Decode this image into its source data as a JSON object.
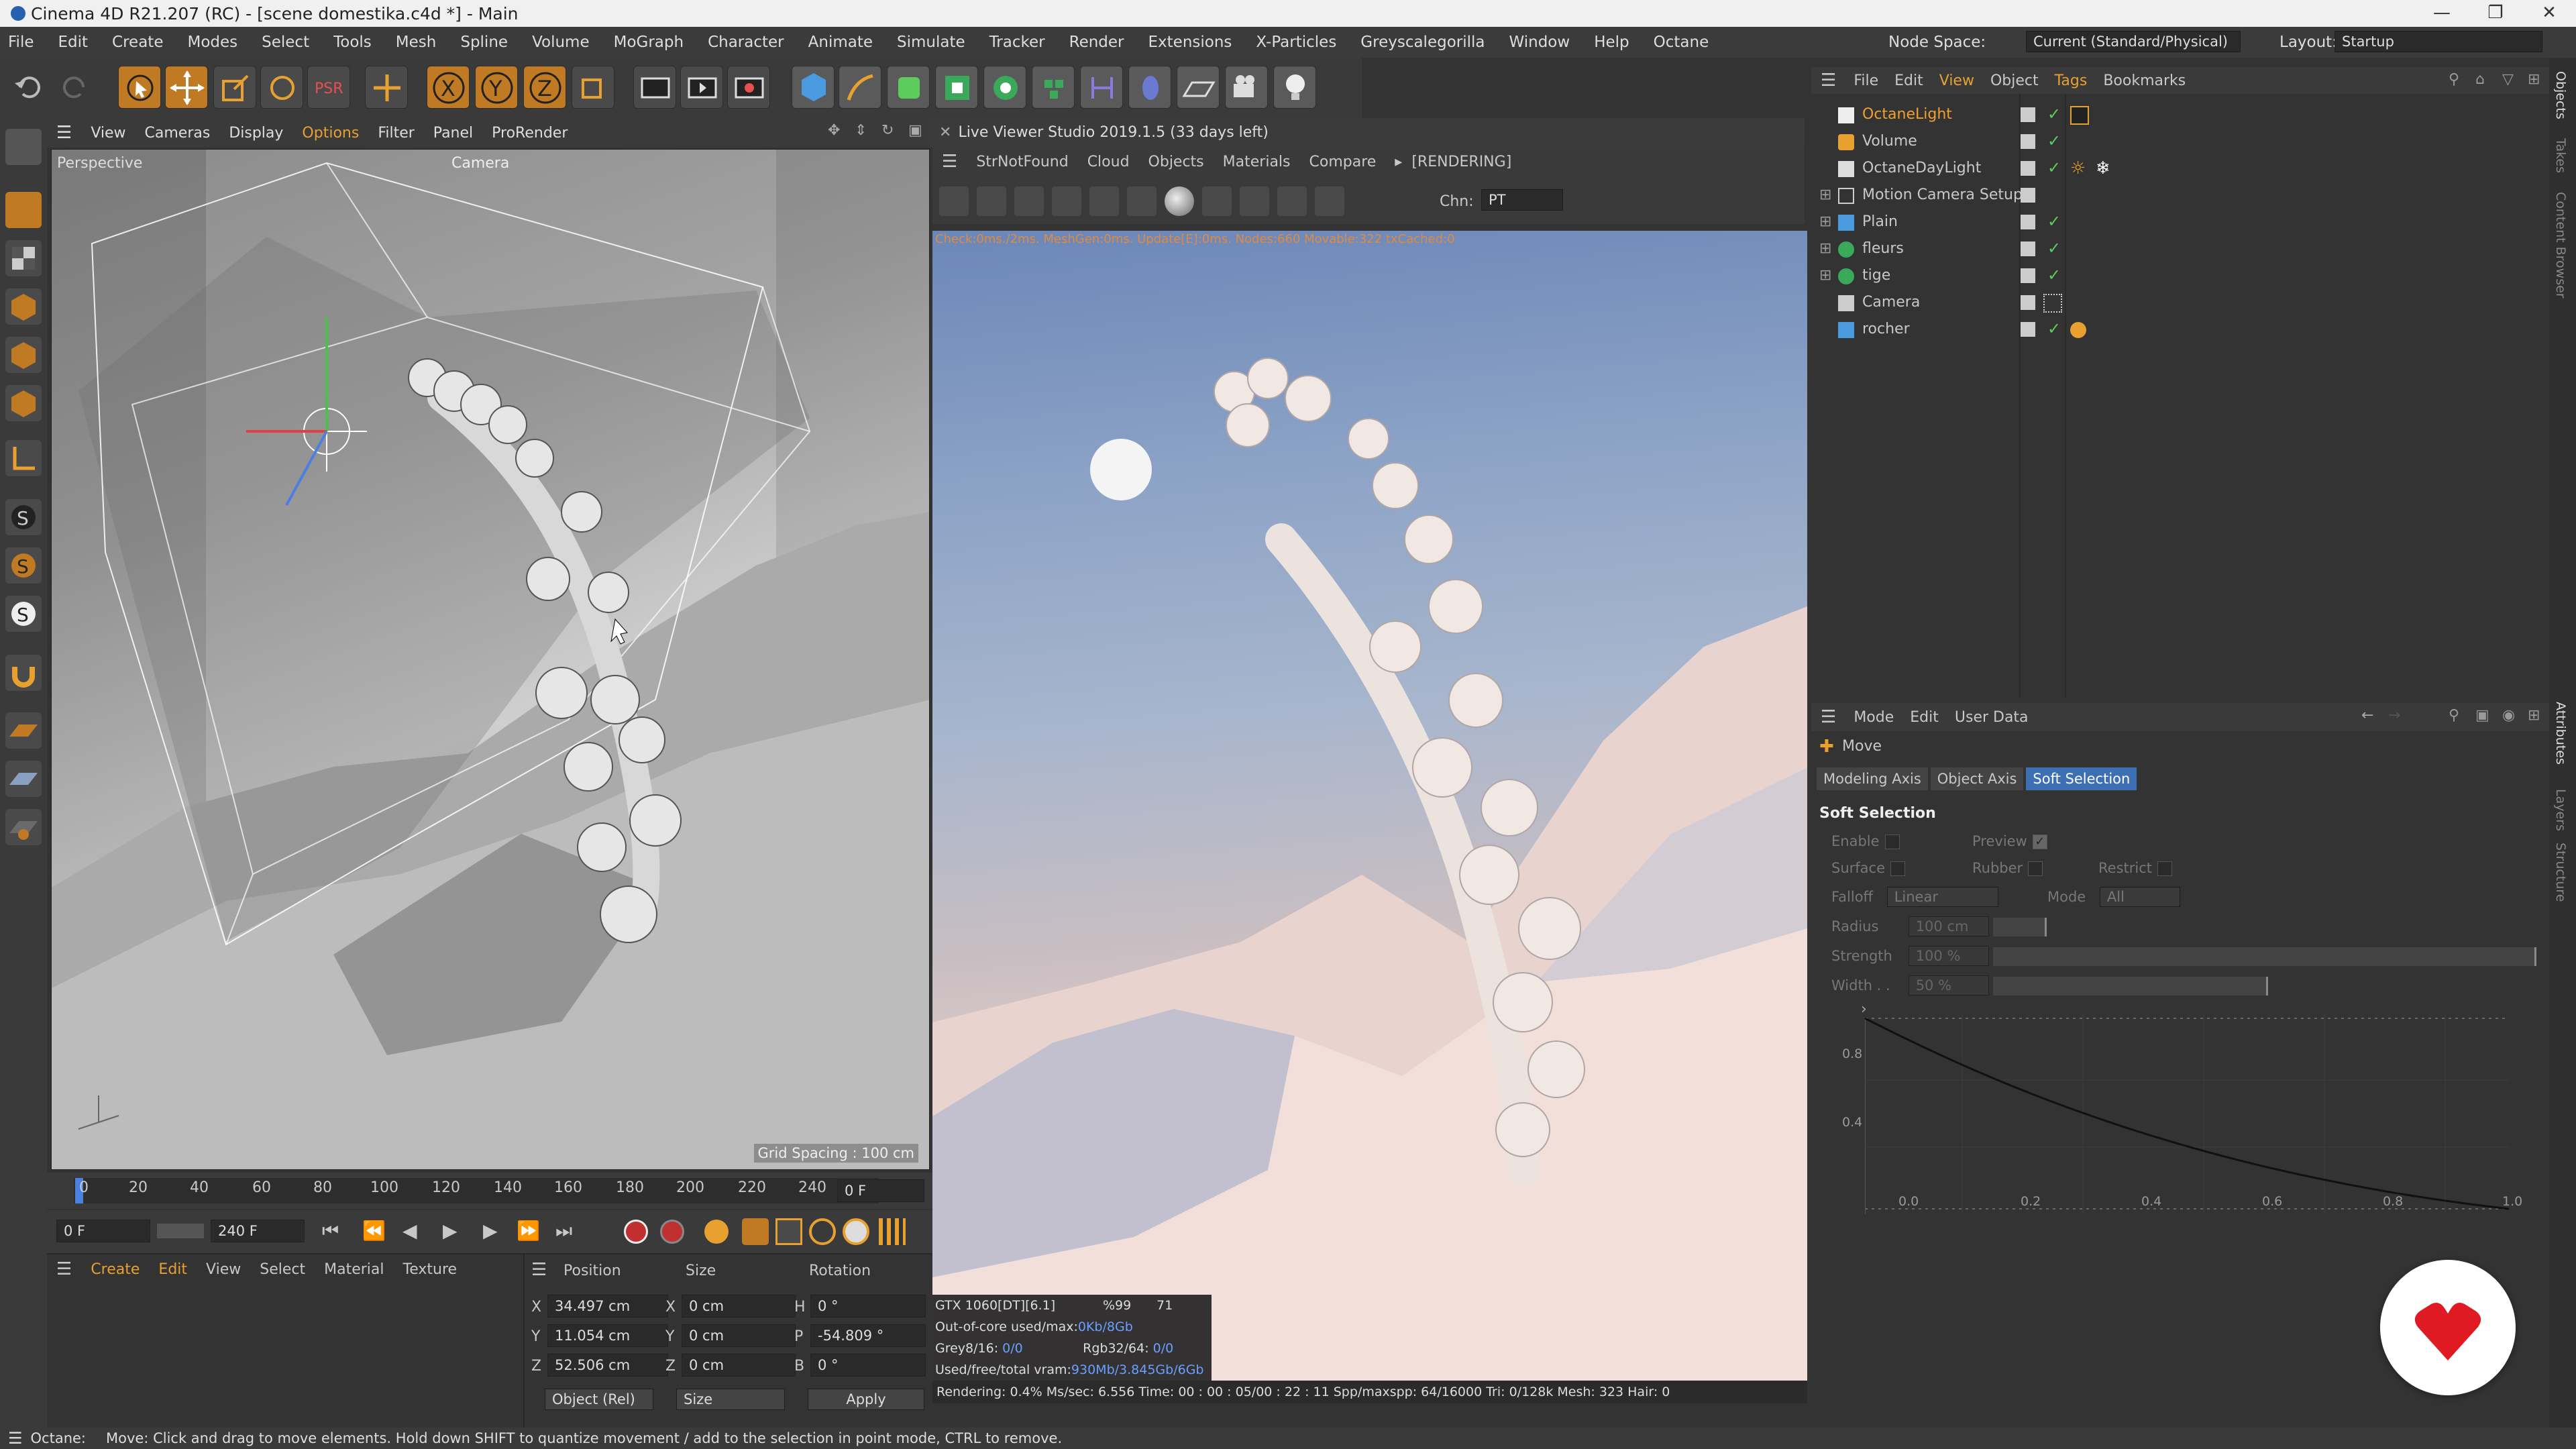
{
  "title": "Cinema 4D R21.207 (RC) - [scene domestika.c4d *] - Main",
  "menu": [
    "File",
    "Edit",
    "Create",
    "Modes",
    "Select",
    "Tools",
    "Mesh",
    "Spline",
    "Volume",
    "MoGraph",
    "Character",
    "Animate",
    "Simulate",
    "Tracker",
    "Render",
    "Extensions",
    "X-Particles",
    "Greyscalegorilla",
    "Window",
    "Help",
    "Octane"
  ],
  "node_space": {
    "label": "Node Space:",
    "value": "Current (Standard/Physical)"
  },
  "layout": {
    "label": "Layout:",
    "value": "Startup"
  },
  "viewport": {
    "menu": [
      "View",
      "Cameras",
      "Display",
      "Options",
      "Filter",
      "Panel",
      "ProRender"
    ],
    "name": "Perspective",
    "camera": "Camera",
    "grid_spacing": "Grid Spacing : 100 cm"
  },
  "timeline": {
    "ticks": [
      "0",
      "20",
      "40",
      "60",
      "80",
      "100",
      "120",
      "140",
      "160",
      "180",
      "200",
      "220",
      "240"
    ],
    "frame_field": "0 F"
  },
  "playback": {
    "start": "0 F",
    "end": "240 F"
  },
  "material_menu": [
    "Create",
    "Edit",
    "View",
    "Select",
    "Material",
    "Texture"
  ],
  "coords": {
    "headers": [
      "Position",
      "Size",
      "Rotation"
    ],
    "rows": [
      {
        "axis": "X",
        "pos": "34.497 cm",
        "size_axis": "X",
        "size": "0 cm",
        "rot_axis": "H",
        "rot": "0 °"
      },
      {
        "axis": "Y",
        "pos": "11.054 cm",
        "size_axis": "Y",
        "size": "0 cm",
        "rot_axis": "P",
        "rot": "-54.809 °"
      },
      {
        "axis": "Z",
        "pos": "52.506 cm",
        "size_axis": "Z",
        "size": "0 cm",
        "rot_axis": "B",
        "rot": "0 °"
      }
    ],
    "mode": "Object (Rel)",
    "size_mode": "Size",
    "apply": "Apply"
  },
  "live_viewer": {
    "title": "Live Viewer Studio 2019.1.5 (33 days left)",
    "menu": [
      "StrNotFound",
      "Cloud",
      "Objects",
      "Materials",
      "Compare"
    ],
    "status": "[RENDERING]",
    "channel_label": "Chn:",
    "channel": "PT",
    "check": "Check:0ms./2ms. MeshGen:0ms. Update[E]:0ms. Nodes:660 Movable:322 txCached:0",
    "gpu": "GTX 1060[DT][6.1]",
    "gpu_pct": "%99",
    "gpu_temp": "71",
    "outofcore_label": "Out-of-core used/max:",
    "outofcore": "0Kb/8Gb",
    "grey_label": "Grey8/16:",
    "grey": "0/0",
    "rgb_label": "Rgb32/64:",
    "rgb": "0/0",
    "vram_label": "Used/free/total vram:",
    "vram": "930Mb/3.845Gb/6Gb",
    "render_status": "Rendering: 0.4%   Ms/sec: 6.556   Time: 00 : 00 : 05/00 : 22 : 11   Spp/maxspp: 64/16000   Tri: 0/128k   Mesh: 323   Hair: 0"
  },
  "obj_menu": [
    "File",
    "Edit",
    "View",
    "Object",
    "Tags",
    "Bookmarks"
  ],
  "objects": [
    {
      "name": "OctaneLight",
      "active": true
    },
    {
      "name": "Volume",
      "active": false
    },
    {
      "name": "OctaneDayLight",
      "active": false
    },
    {
      "name": "Motion Camera Setup",
      "active": false
    },
    {
      "name": "Plain",
      "active": false
    },
    {
      "name": "fleurs",
      "active": false
    },
    {
      "name": "tige",
      "active": false
    },
    {
      "name": "Camera",
      "active": false
    },
    {
      "name": "rocher",
      "active": false
    }
  ],
  "attr_menu": [
    "Mode",
    "Edit",
    "User Data"
  ],
  "attr": {
    "tool": "Move",
    "tabs": [
      "Modeling Axis",
      "Object Axis",
      "Soft Selection"
    ],
    "selected_tab": "Soft Selection",
    "section": "Soft Selection",
    "enable": "Enable",
    "preview": "Preview",
    "surface": "Surface",
    "rubber": "Rubber",
    "restrict": "Restrict",
    "falloff_label": "Falloff",
    "falloff": "Linear",
    "mode_label": "Mode",
    "mode": "All",
    "radius_label": "Radius",
    "radius": "100 cm",
    "strength_label": "Strength",
    "strength": "100 %",
    "width_label": "Width . .",
    "width": "50 %",
    "graph_y": [
      "0.8",
      "0.4"
    ],
    "graph_x": [
      "0.0",
      "0.2",
      "0.4",
      "0.6",
      "0.8",
      "1.0"
    ]
  },
  "right_tabs": [
    "Objects",
    "Takes",
    "Content Browser",
    "Attributes",
    "Layers",
    "Structure"
  ],
  "statusbar": {
    "app": "Octane:",
    "message": "Move: Click and drag to move elements. Hold down SHIFT to quantize movement / add to the selection in point mode, CTRL to remove."
  },
  "colors": {
    "accent": "#c07a24",
    "selection": "#3d6fb5",
    "active_object": "#f0a030",
    "check": "#5ccc5c",
    "logo": "#e01a22"
  }
}
